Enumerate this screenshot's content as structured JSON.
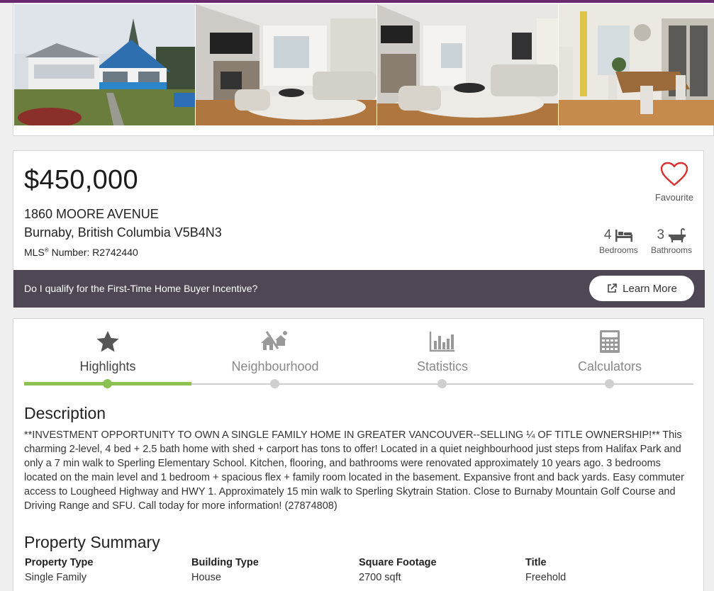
{
  "listing": {
    "price": "$450,000",
    "address_line1": "1860 MOORE AVENUE",
    "address_line2": "Burnaby, British Columbia V5B4N3",
    "mls_prefix": "MLS",
    "mls_reg": "®",
    "mls_label": " Number: R2742440",
    "favourite_label": "Favourite",
    "bedrooms_count": "4",
    "bedrooms_label": "Bedrooms",
    "bathrooms_count": "3",
    "bathrooms_label": "Bathrooms",
    "photos": [
      "exterior",
      "living-room",
      "living-room-2",
      "dining-room"
    ]
  },
  "banner": {
    "text": "Do I qualify for the First-Time Home Buyer Incentive?",
    "button_label": "Learn More"
  },
  "tabs": [
    {
      "label": "Highlights",
      "icon": "star-icon",
      "active": true
    },
    {
      "label": "Neighbourhood",
      "icon": "neighbourhood-icon",
      "active": false
    },
    {
      "label": "Statistics",
      "icon": "bar-chart-icon",
      "active": false
    },
    {
      "label": "Calculators",
      "icon": "calculator-icon",
      "active": false
    }
  ],
  "description": {
    "heading": "Description",
    "text": "**INVESTMENT OPPORTUNITY TO OWN A SINGLE FAMILY HOME IN GREATER VANCOUVER--SELLING ¼ OF TITLE OWNERSHIP!** This charming 2-level, 4 bed + 2.5 bath home with shed + carport has tons to offer! Located in a quiet neighbourhood just steps from Halifax Park and only a 7 min walk to Sperling Elementary School. Kitchen, flooring, and bathrooms were renovated approximately 10 years ago. 3 bedrooms located on the main level and 1 bedroom + spacious flex + family room located in the basement. Expansive front and back yards. Easy commuter access to Lougheed Highway and HWY 1. Approximately 15 min walk to Sperling Skytrain Station. Close to Burnaby Mountain Golf Course and Driving Range and SFU. Call today for more information! (27874808)"
  },
  "summary": {
    "heading": "Property Summary",
    "columns": [
      {
        "label": "Property Type",
        "value": "Single Family"
      },
      {
        "label": "Building Type",
        "value": "House"
      },
      {
        "label": "Square Footage",
        "value": "2700 sqft"
      },
      {
        "label": "Title",
        "value": "Freehold"
      }
    ]
  },
  "colors": {
    "accent_green": "#8cc152",
    "banner_bg": "#4f4754",
    "heart_red": "#d9302f",
    "top_bar": "#6b2a70"
  }
}
